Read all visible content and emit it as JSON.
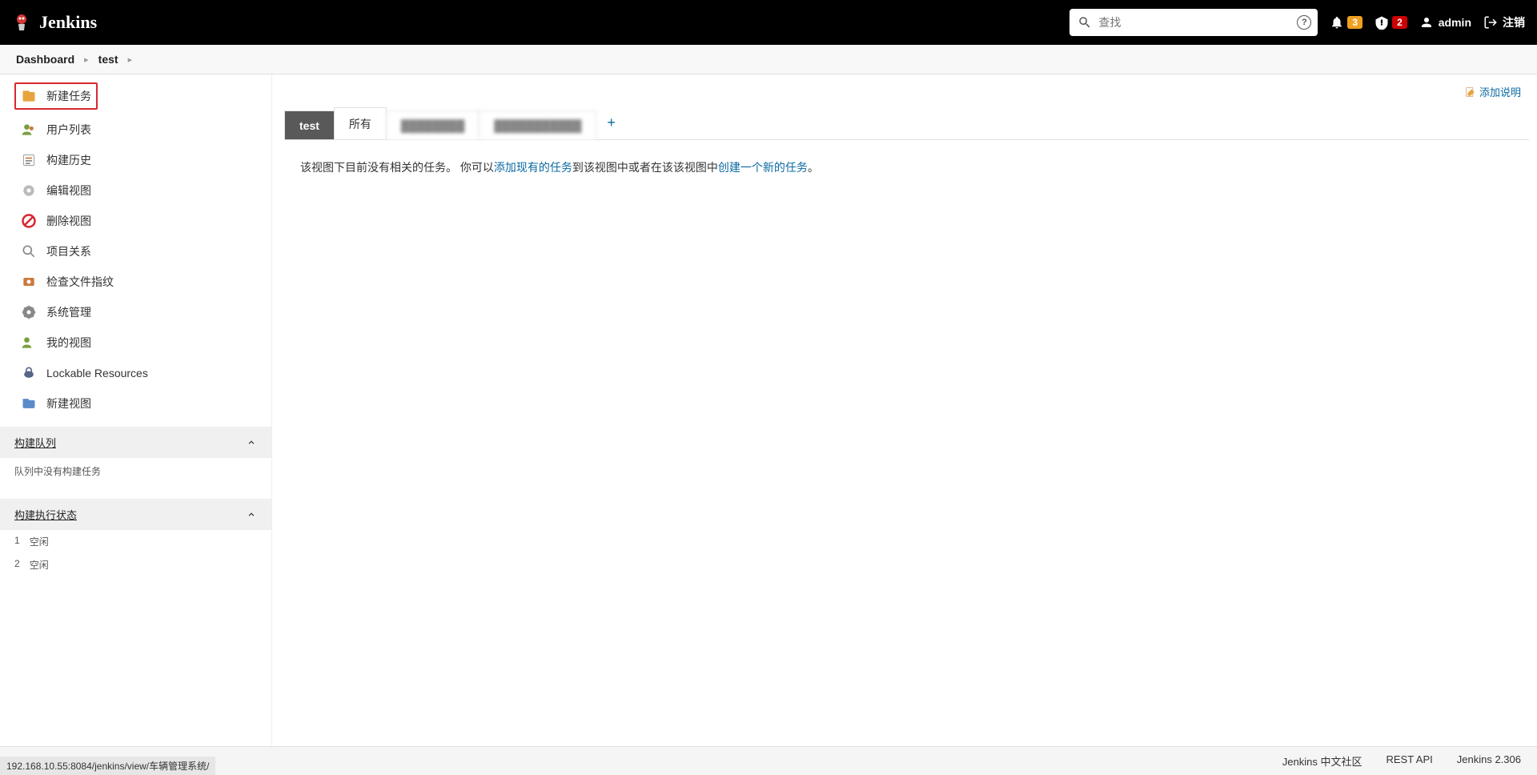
{
  "header": {
    "brand": "Jenkins",
    "search_placeholder": "查找",
    "notif_count": "3",
    "alert_count": "2",
    "username": "admin",
    "logout_label": "注销"
  },
  "breadcrumb": {
    "items": [
      "Dashboard",
      "test"
    ]
  },
  "sidebar": {
    "items": [
      {
        "label": "新建任务",
        "highlighted": true
      },
      {
        "label": "用户列表"
      },
      {
        "label": "构建历史"
      },
      {
        "label": "编辑视图"
      },
      {
        "label": "删除视图"
      },
      {
        "label": "项目关系"
      },
      {
        "label": "检查文件指纹"
      },
      {
        "label": "系统管理"
      },
      {
        "label": "我的视图"
      },
      {
        "label": "Lockable Resources"
      },
      {
        "label": "新建视图"
      }
    ],
    "build_queue_title": "构建队列",
    "build_queue_empty": "队列中没有构建任务",
    "executor_title": "构建执行状态",
    "executors": [
      {
        "num": "1",
        "state": "空闲"
      },
      {
        "num": "2",
        "state": "空闲"
      }
    ]
  },
  "main": {
    "add_description": "添加说明",
    "tabs": [
      {
        "label": "test",
        "active": true
      },
      {
        "label": "所有"
      },
      {
        "label": "████████",
        "blur": true
      },
      {
        "label": "███████████",
        "blur": true
      }
    ],
    "empty_prefix": "该视图下目前没有相关的任务。  你可以",
    "empty_link1": "添加现有的任务",
    "empty_mid": "到该视图中或者在该该视图中",
    "empty_link2": "创建一个新的任务",
    "empty_suffix": "。"
  },
  "footer": {
    "community": "Jenkins 中文社区",
    "rest_api": "REST API",
    "version": "Jenkins 2.306"
  },
  "status_url": "192.168.10.55:8084/jenkins/view/车辆管理系统/"
}
